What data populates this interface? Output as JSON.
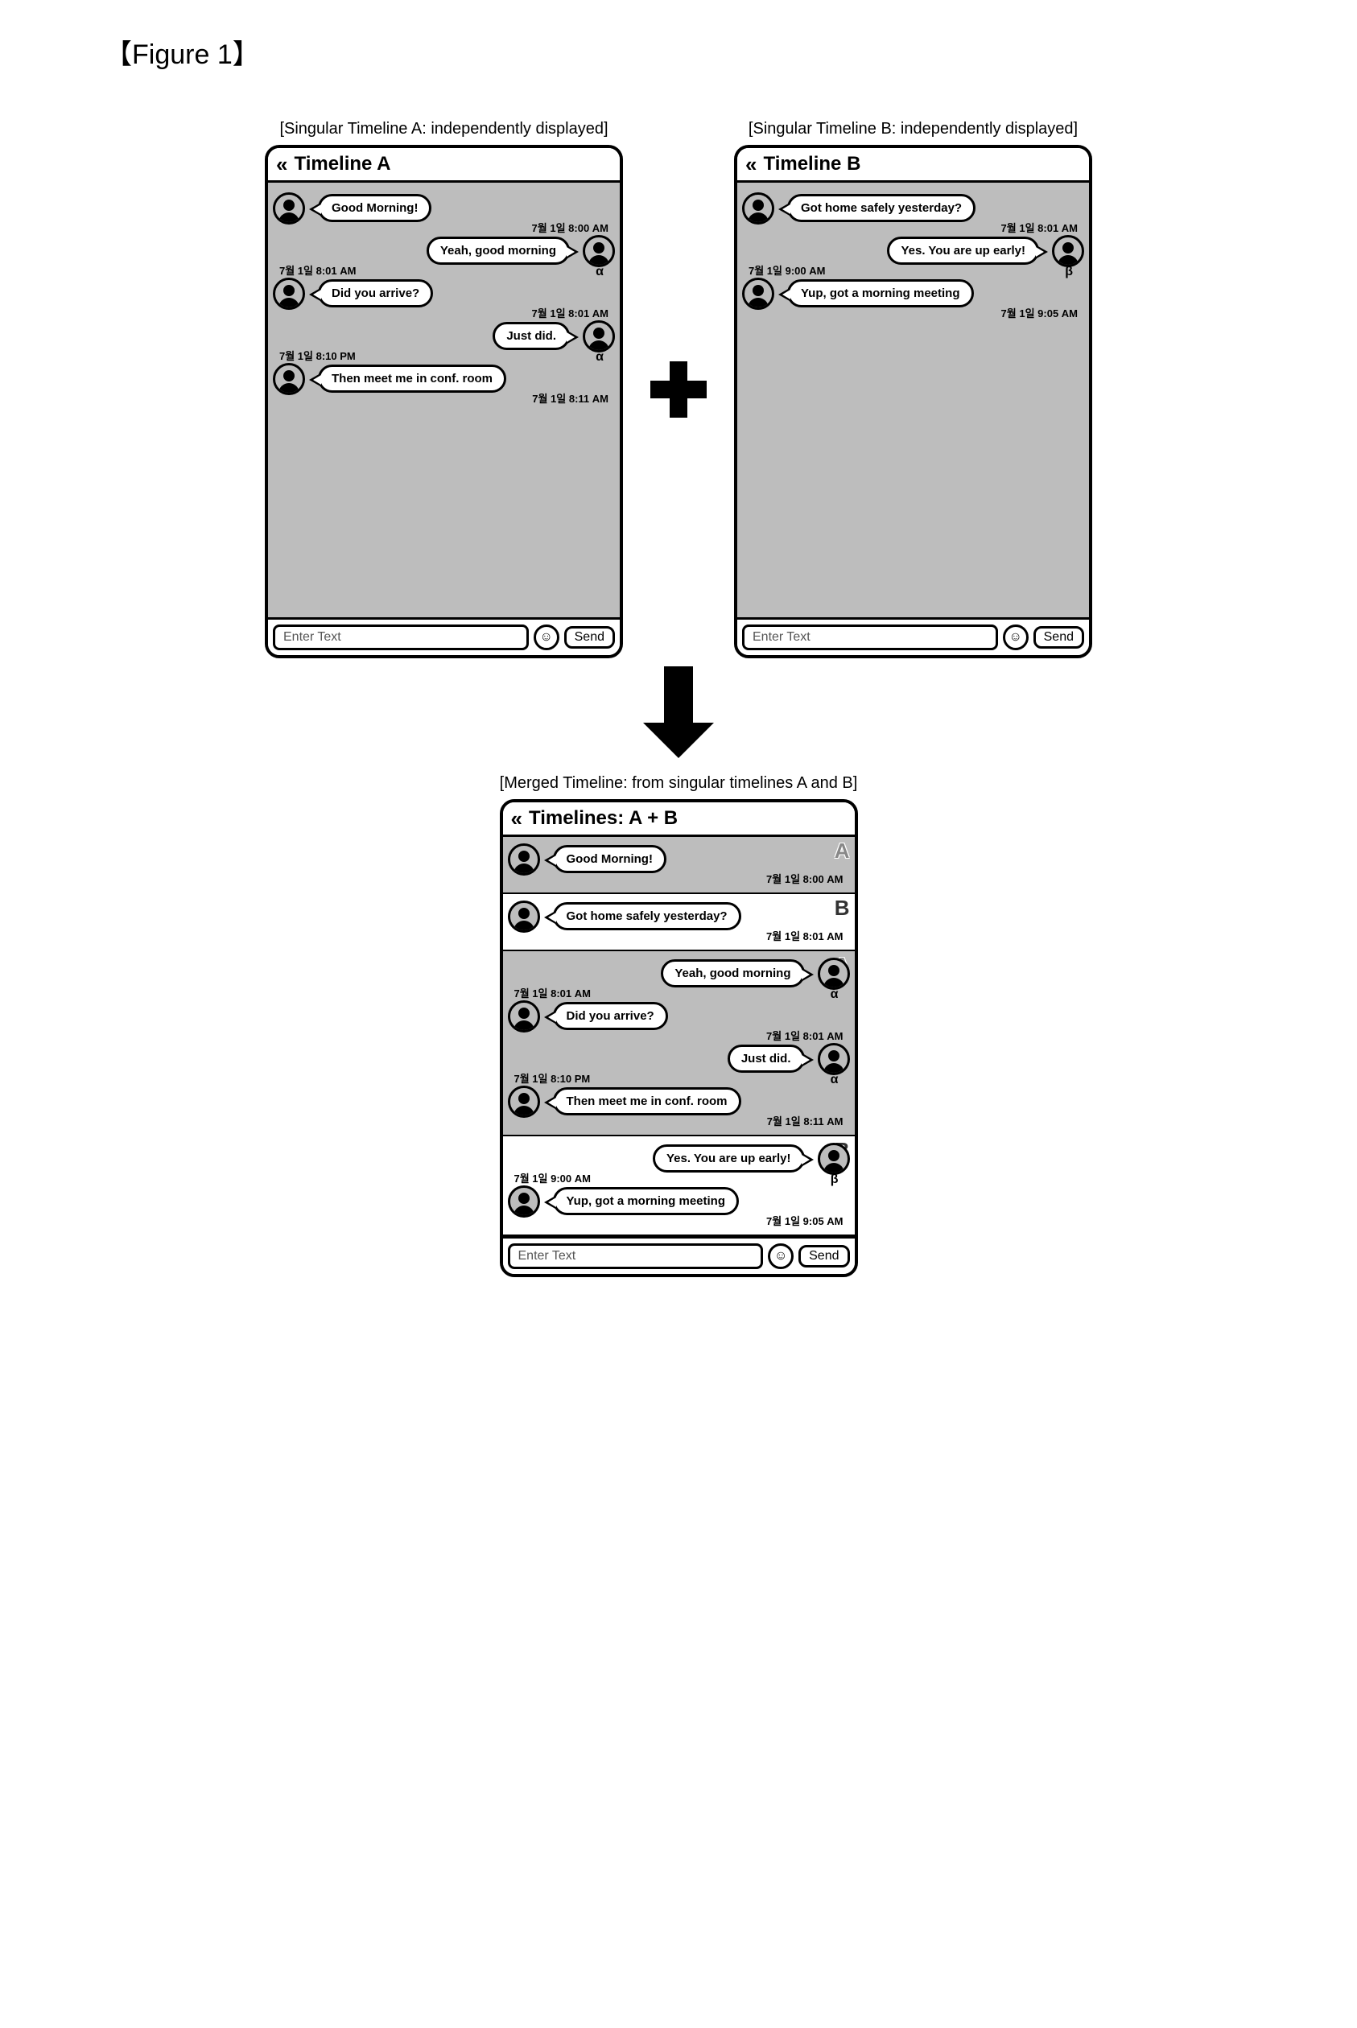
{
  "figure_label": "【Figure 1】",
  "captions": {
    "a": "[Singular Timeline A: independently displayed]",
    "b": "[Singular Timeline B: independently displayed]",
    "merged": "[Merged Timeline: from singular timelines A and B]"
  },
  "common": {
    "input_placeholder": "Enter Text",
    "send_label": "Send",
    "emoji_glyph": "☺"
  },
  "timeline_a": {
    "title": "Timeline A",
    "messages": [
      {
        "side": "left",
        "text": "Good Morning!",
        "ts": "7월 1일 8:00 AM"
      },
      {
        "side": "right",
        "text": "Yeah, good morning",
        "ts": "7월 1일 8:01 AM",
        "avatar_label": "α"
      },
      {
        "side": "left",
        "text": "Did you arrive?",
        "ts": "7월 1일 8:01 AM"
      },
      {
        "side": "right",
        "text": "Just did.",
        "ts": "7월 1일 8:10 PM",
        "avatar_label": "α"
      },
      {
        "side": "left",
        "text": "Then meet me in conf. room",
        "ts": "7월 1일 8:11 AM"
      }
    ]
  },
  "timeline_b": {
    "title": "Timeline B",
    "messages": [
      {
        "side": "left",
        "text": "Got home safely yesterday?",
        "ts": "7월 1일 8:01 AM"
      },
      {
        "side": "right",
        "text": "Yes. You are up early!",
        "ts": "7월 1일 9:00 AM",
        "avatar_label": "β"
      },
      {
        "side": "left",
        "text": "Yup, got a morning meeting",
        "ts": "7월 1일 9:05 AM"
      }
    ]
  },
  "merged": {
    "title": "Timelines: A + B",
    "sections": [
      {
        "thread": "A",
        "bg": "gray",
        "messages": [
          {
            "side": "left",
            "text": "Good Morning!",
            "ts": "7월 1일 8:00 AM"
          }
        ]
      },
      {
        "thread": "B",
        "bg": "white",
        "messages": [
          {
            "side": "left",
            "text": "Got home safely yesterday?",
            "ts": "7월 1일 8:01 AM"
          }
        ]
      },
      {
        "thread": "A",
        "bg": "gray",
        "messages": [
          {
            "side": "right",
            "text": "Yeah, good morning",
            "ts": "7월 1일 8:01 AM",
            "avatar_label": "α"
          },
          {
            "side": "left",
            "text": "Did you arrive?",
            "ts": "7월 1일 8:01 AM"
          },
          {
            "side": "right",
            "text": "Just did.",
            "ts": "7월 1일 8:10 PM",
            "avatar_label": "α"
          },
          {
            "side": "left",
            "text": "Then meet me in conf. room",
            "ts": "7월 1일 8:11 AM"
          }
        ],
        "tag_after_first": true
      },
      {
        "thread": "B",
        "bg": "white",
        "messages": [
          {
            "side": "right",
            "text": "Yes. You are up early!",
            "ts": "7월 1일 9:00 AM",
            "avatar_label": "β"
          },
          {
            "side": "left",
            "text": "Yup, got a morning meeting",
            "ts": "7월 1일 9:05 AM"
          }
        ]
      }
    ]
  }
}
